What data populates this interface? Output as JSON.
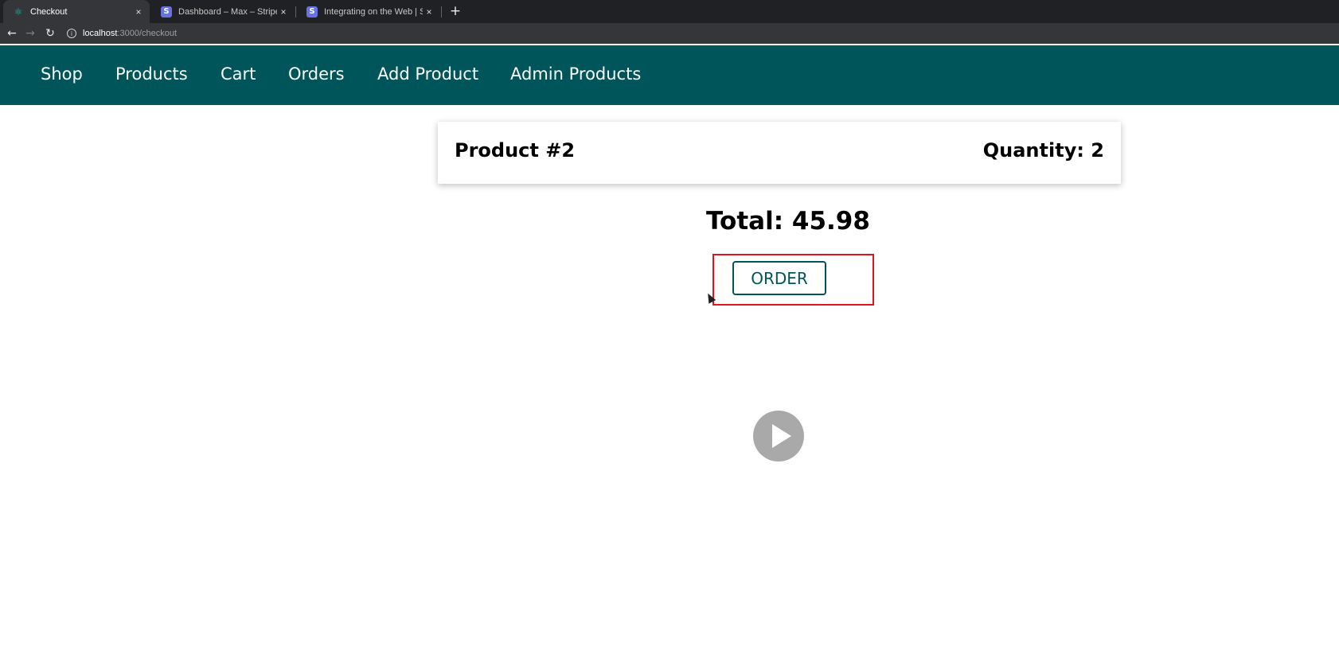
{
  "browser": {
    "tabs": [
      {
        "title": "Checkout",
        "icon": "react-icon",
        "active": true
      },
      {
        "title": "Dashboard – Max – Stripe [Te…",
        "icon": "stripe-icon",
        "active": false
      },
      {
        "title": "Integrating on the Web | Stripe",
        "icon": "stripe-icon",
        "active": false
      }
    ],
    "tab_close": "×",
    "new_tab": "+",
    "nav": {
      "back": "←",
      "forward": "→",
      "reload": "↻"
    },
    "info_glyph": "i",
    "url_host": "localhost",
    "url_path": ":3000/checkout"
  },
  "app": {
    "nav": [
      "Shop",
      "Products",
      "Cart",
      "Orders",
      "Add Product",
      "Admin Products"
    ],
    "header_color": "#00555a"
  },
  "checkout": {
    "item_name": "Product #2",
    "item_quantity": "Quantity: 2",
    "total": "Total: 45.98",
    "order_button": "ORDER",
    "highlight_color": "#e0141e"
  }
}
